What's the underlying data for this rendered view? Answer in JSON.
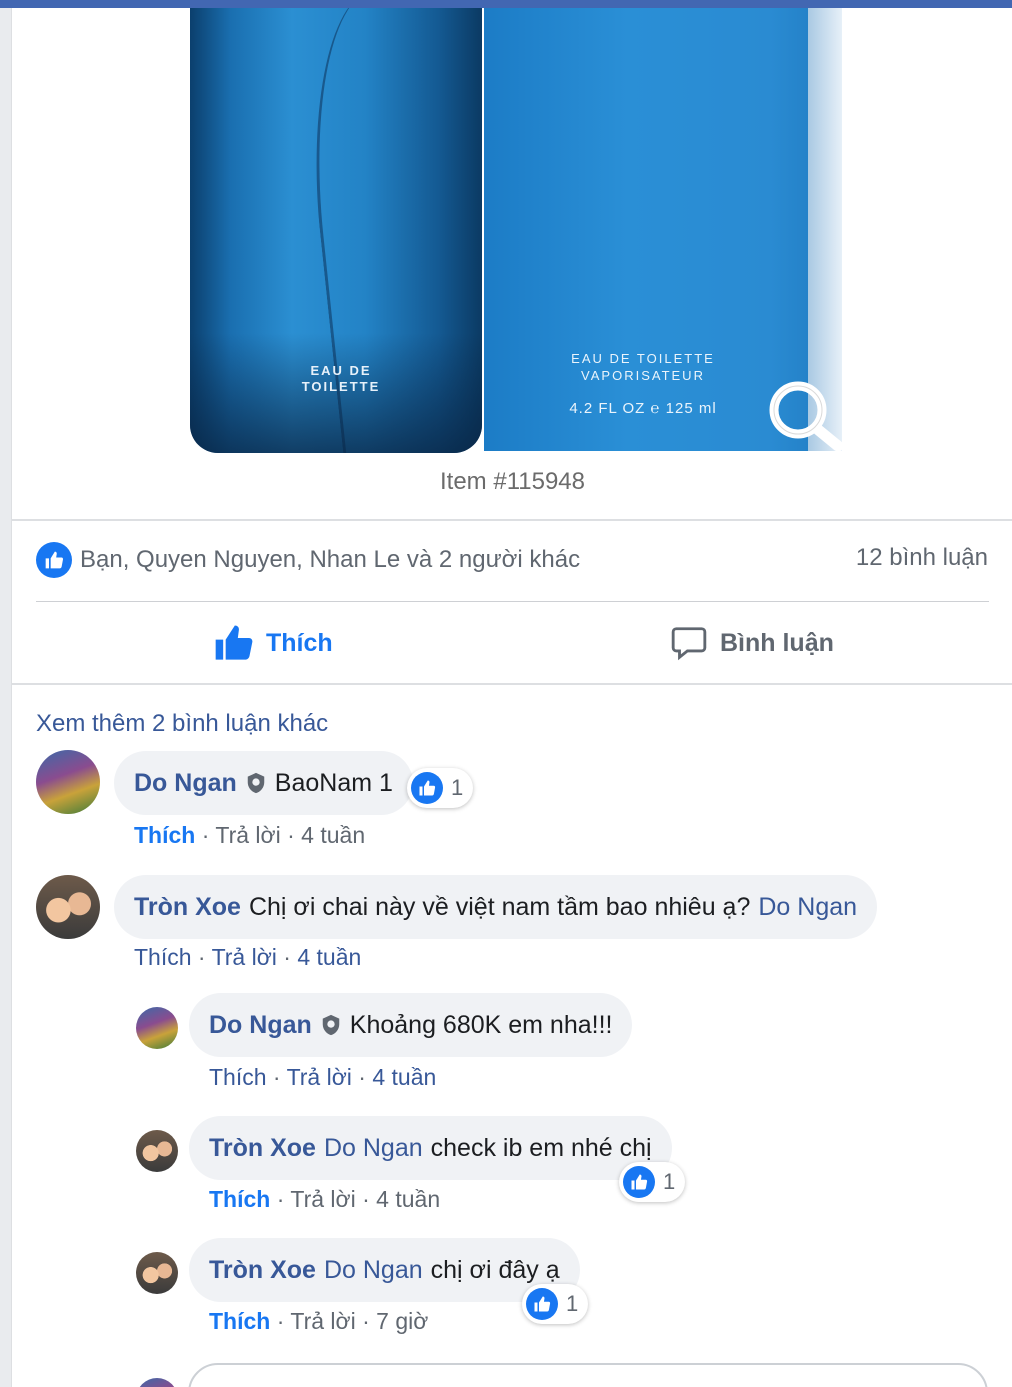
{
  "product": {
    "bottle_label": "EAU DE TOILETTE",
    "box_label": "EAU DE TOILETTE VAPORISATEUR",
    "box_volume": "4.2 FL OZ ℮ 125 ml",
    "item_number": "Item #115948"
  },
  "reactions": {
    "likers": "Bạn, Quyen Nguyen, Nhan Le và 2 người khác",
    "comment_count": "12 bình luận"
  },
  "actions": {
    "like_label": "Thích",
    "comment_label": "Bình luận"
  },
  "view_more": "Xem thêm 2 bình luận khác",
  "comments": [
    {
      "author": "Do Ngan",
      "text": "BaoNam 1",
      "like_label": "Thích",
      "reply_label": "Trả lời",
      "time": "4 tuần",
      "reaction_count": "1"
    },
    {
      "author": "Tròn Xoe",
      "text": "Chị ơi chai này về việt nam tầm bao nhiêu ạ?",
      "tag": "Do Ngan",
      "like_label": "Thích",
      "reply_label": "Trả lời",
      "time": "4 tuần"
    }
  ],
  "replies": [
    {
      "author": "Do Ngan",
      "text": "Khoảng 680K em nha!!!",
      "like_label": "Thích",
      "reply_label": "Trả lời",
      "time": "4 tuần"
    },
    {
      "author": "Tròn Xoe",
      "tag": "Do Ngan",
      "text": "check ib em nhé chị",
      "like_label": "Thích",
      "reply_label": "Trả lời",
      "time": "4 tuần",
      "reaction_count": "1"
    },
    {
      "author": "Tròn Xoe",
      "tag": "Do Ngan",
      "text": "chị ơi đây ạ",
      "like_label": "Thích",
      "reply_label": "Trả lời",
      "time": "7 giờ",
      "reaction_count": "1"
    }
  ],
  "colors": {
    "brand": "#4267b2",
    "like_blue": "#1877f2",
    "link": "#385898",
    "bubble": "#f0f2f5"
  }
}
